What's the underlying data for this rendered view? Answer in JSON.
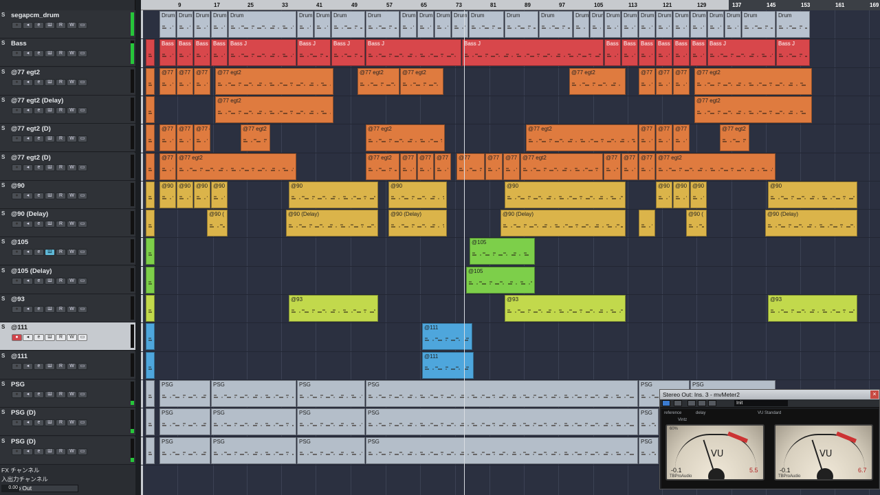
{
  "ruler": {
    "bars": [
      "9",
      "17",
      "25",
      "33",
      "41",
      "49",
      "57",
      "65",
      "73",
      "81",
      "89",
      "97",
      "105",
      "113",
      "121",
      "129",
      "137",
      "145",
      "153",
      "161",
      "169"
    ]
  },
  "tracks": [
    {
      "name": "segapcm_drum",
      "s": "S"
    },
    {
      "name": "Bass",
      "s": "S"
    },
    {
      "name": "@77 egt2",
      "s": "S"
    },
    {
      "name": "@77 egt2 (Delay)",
      "s": "S"
    },
    {
      "name": "@77 egt2 (D)",
      "s": "S"
    },
    {
      "name": "@77 egt2 (D)",
      "s": "S"
    },
    {
      "name": "@90",
      "s": "S"
    },
    {
      "name": "@90 (Delay)",
      "s": "S"
    },
    {
      "name": "@105",
      "s": "S"
    },
    {
      "name": "@105 (Delay)",
      "s": "S"
    },
    {
      "name": "@93",
      "s": "S"
    },
    {
      "name": "@111",
      "s": "S"
    },
    {
      "name": "@111",
      "s": "S"
    },
    {
      "name": "PSG",
      "s": "S"
    },
    {
      "name": "PSG (D)",
      "s": "S"
    },
    {
      "name": "PSG (D)",
      "s": "S"
    }
  ],
  "track_buttons": [
    "●",
    "◂",
    "e",
    "Ш",
    "R",
    "W",
    "▭"
  ],
  "bottom": {
    "fx_channel": "FX チャンネル",
    "io_channel": "入出力チャンネル",
    "master": "Stereo Out",
    "master_value": "0.00"
  },
  "clip_labels": {
    "drum": "Drum",
    "bass": "Bass",
    "bass_j": "Bass J",
    "egt2": "@77 egt2",
    "egt_short": "@77",
    "egt_cut": "@77 e",
    "p90": "@90",
    "p90d": "@90 (Delay)",
    "p90_cut": "@90 (",
    "p105": "@105",
    "p93": "@93",
    "p111": "@111",
    "psg": "PSG"
  },
  "plugin": {
    "title": "Stereo Out: Ins. 3 - mvMeter2",
    "close": "×",
    "preset": "Init",
    "vu_label": "VU",
    "brand": "TBProAudio",
    "left": {
      "peak_l": "-0.1",
      "peak_r": "5.5"
    },
    "right": {
      "peak_l": "-0.1",
      "peak_r": "6.7"
    },
    "small": {
      "reference": "reference",
      "delay": "delay",
      "vu_standard": "VU Standard",
      "vintz": "Vintz",
      "pct": "60%"
    }
  },
  "colors": {
    "drum": "#b8c2cf",
    "bass": "#d8474b",
    "egt": "#df7b3f",
    "p90": "#dbb44a",
    "p105": "#7dcf4a",
    "p93": "#c2d94c",
    "p111": "#4ea6dc",
    "psg": "#b4bec9"
  }
}
